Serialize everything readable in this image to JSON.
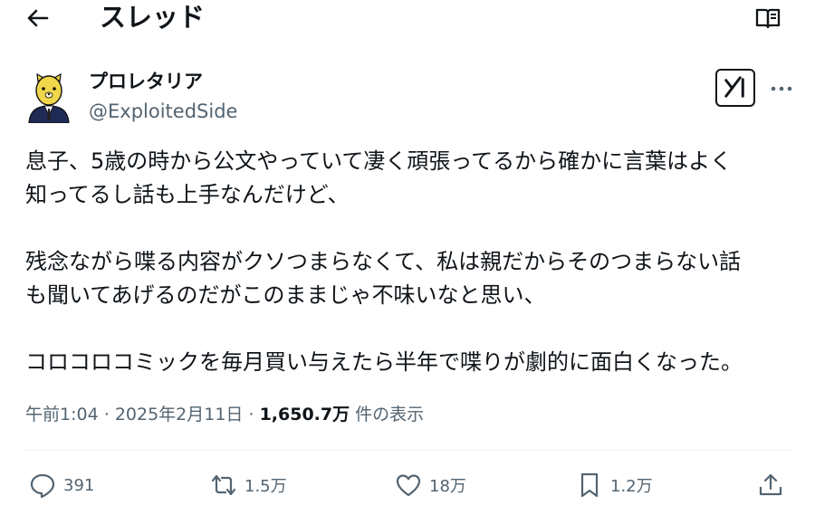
{
  "header": {
    "title": "スレッド",
    "back_icon": "arrow-left-icon",
    "reader_icon": "book-open-icon"
  },
  "author": {
    "name": "プロレタリア",
    "handle": "@ExploitedSide"
  },
  "tweet": {
    "lines": [
      "息子、5歳の時から公文やっていて凄く頑張ってるから確かに言葉はよく",
      "知ってるし話も上手なんだけど、",
      "",
      "残念ながら喋る内容がクソつまらなくて、私は親だからそのつまらない話",
      "も聞いてあげるのだがこのままじゃ不味いなと思い、",
      "",
      "コロコロコミックを毎月買い与えたら半年で喋りが劇的に面白くなった。"
    ]
  },
  "meta": {
    "time": "午前1:04",
    "sep": "·",
    "date": "2025年2月11日",
    "views": "1,650.7万",
    "views_suffix": "件の表示"
  },
  "actions": {
    "replies": "391",
    "retweets": "1.5万",
    "likes": "18万",
    "bookmarks": "1.2万"
  },
  "colors": {
    "text": "#0f1419",
    "secondary": "#536471",
    "divider": "#eff3f4"
  }
}
